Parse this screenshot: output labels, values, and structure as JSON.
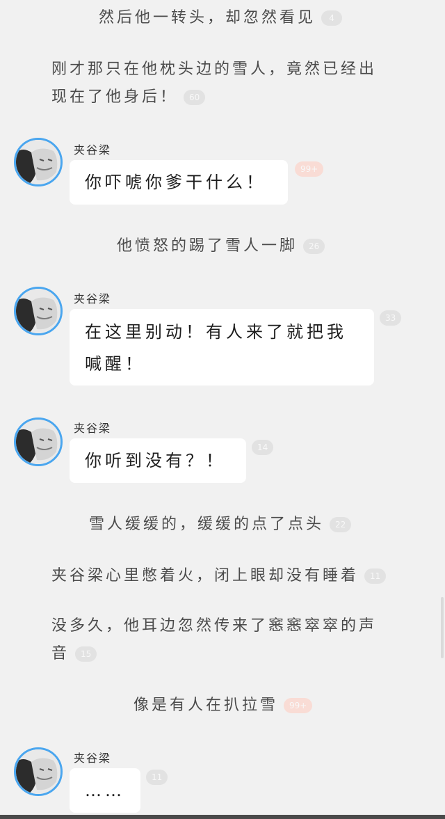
{
  "narrations": [
    {
      "text": "然后他一转头，却忽然看见",
      "count": "4"
    },
    {
      "text": "刚才那只在他枕头边的雪人，竟然已经出现在了他身后！",
      "count": "60"
    },
    {
      "text": "他愤怒的踢了雪人一脚",
      "count": "26"
    },
    {
      "text": "雪人缓缓的，缓缓的点了点头",
      "count": "22"
    },
    {
      "text": "夹谷梁心里憋着火，闭上眼却没有睡着",
      "count": "11"
    },
    {
      "text": "没多久，他耳边忽然传来了窸窸窣窣的声音",
      "count": "15"
    },
    {
      "text": "像是有人在扒拉雪",
      "count": "99+"
    }
  ],
  "messages": [
    {
      "speaker": "夹谷梁",
      "text": "你吓唬你爹干什么！",
      "count": "99+"
    },
    {
      "speaker": "夹谷梁",
      "text": "在这里别动！有人来了就把我喊醒！",
      "count": "33"
    },
    {
      "speaker": "夹谷梁",
      "text": "你听到没有？！",
      "count": "14"
    },
    {
      "speaker": "夹谷梁",
      "text": "……",
      "count": "11"
    }
  ],
  "icons": {
    "avatar": "avatar-portrait-icon"
  },
  "colors": {
    "background": "#f1f1f1",
    "bubble": "#ffffff",
    "avatar_ring": "#4aa6ef",
    "count_badge": "#e2e2e2",
    "count_badge_hot": "#f9dcd5"
  }
}
